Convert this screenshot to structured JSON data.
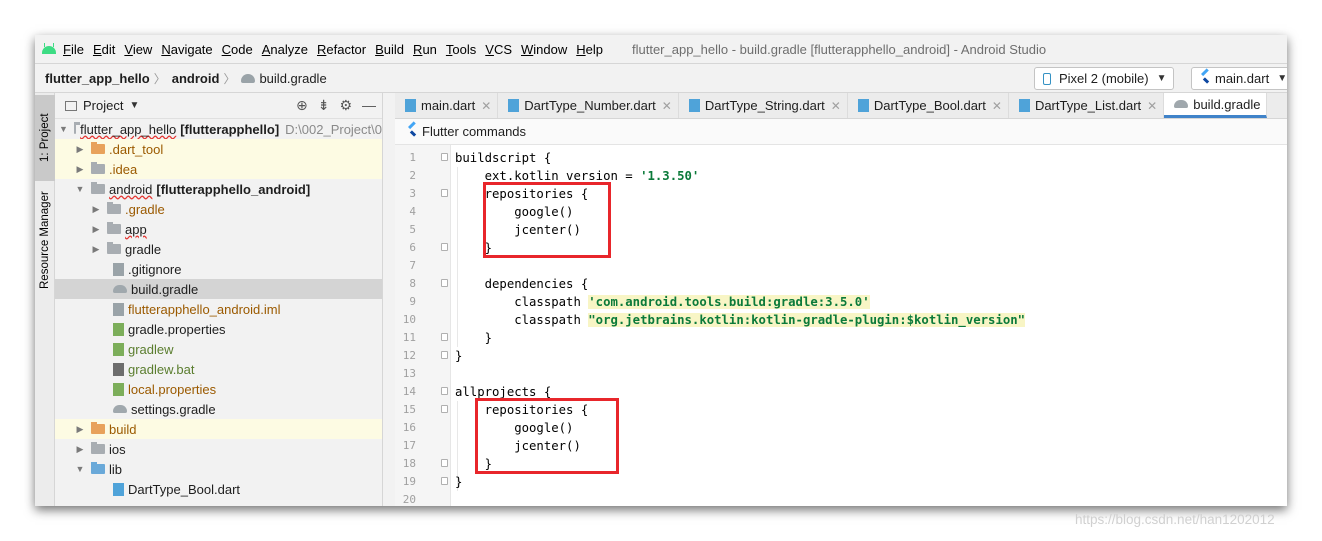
{
  "menu": {
    "items": [
      "File",
      "Edit",
      "View",
      "Navigate",
      "Code",
      "Analyze",
      "Refactor",
      "Build",
      "Run",
      "Tools",
      "VCS",
      "Window",
      "Help"
    ],
    "window_title": "flutter_app_hello - build.gradle [flutterapphello_android] - Android Studio"
  },
  "breadcrumb": {
    "project": "flutter_app_hello",
    "module": "android",
    "file": "build.gradle"
  },
  "toolbar": {
    "device": "Pixel 2 (mobile)",
    "run_config": "main.dart"
  },
  "side_stripe": {
    "project_tab": "1: Project",
    "resource_tab": "Resource Manager"
  },
  "project_panel": {
    "view_label": "Project",
    "tree": [
      {
        "name": "flutter_app_hello",
        "suffix": "[flutterapphello]",
        "path": "D:\\002_Project\\0"
      },
      {
        "name": ".dart_tool"
      },
      {
        "name": ".idea"
      },
      {
        "name": "android",
        "suffix": "[flutterapphello_android]"
      },
      {
        "name": ".gradle"
      },
      {
        "name": "app"
      },
      {
        "name": "gradle"
      },
      {
        "name": ".gitignore"
      },
      {
        "name": "build.gradle"
      },
      {
        "name": "flutterapphello_android.iml"
      },
      {
        "name": "gradle.properties"
      },
      {
        "name": "gradlew"
      },
      {
        "name": "gradlew.bat"
      },
      {
        "name": "local.properties"
      },
      {
        "name": "settings.gradle"
      },
      {
        "name": "build"
      },
      {
        "name": "ios"
      },
      {
        "name": "lib"
      },
      {
        "name": "DartType_Bool.dart"
      }
    ]
  },
  "editor": {
    "tabs": [
      "main.dart",
      "DartType_Number.dart",
      "DartType_String.dart",
      "DartType_Bool.dart",
      "DartType_List.dart",
      "build.gradle"
    ],
    "active_tab": "build.gradle",
    "flutter_bar": "Flutter commands",
    "line_numbers": [
      "1",
      "2",
      "3",
      "4",
      "5",
      "6",
      "7",
      "8",
      "9",
      "10",
      "11",
      "12",
      "13",
      "14",
      "15",
      "16",
      "17",
      "18",
      "19",
      "20"
    ],
    "lines": [
      {
        "plain": "buildscript {"
      },
      {
        "plain": "    ext.kotlin_version = ",
        "str": "'1.3.50'"
      },
      {
        "plain": "    repositories {"
      },
      {
        "plain": "        google()"
      },
      {
        "plain": "        jcenter()"
      },
      {
        "plain": "    }"
      },
      {
        "plain": ""
      },
      {
        "plain": "    dependencies {"
      },
      {
        "plain": "        classpath ",
        "str": "'com.android.tools.build:gradle:3.5.0'"
      },
      {
        "plain": "        classpath ",
        "str": "\"org.jetbrains.kotlin:kotlin-gradle-plugin:$kotlin_version\""
      },
      {
        "plain": "    }"
      },
      {
        "plain": "}"
      },
      {
        "plain": ""
      },
      {
        "plain": "allprojects {"
      },
      {
        "plain": "    repositories {"
      },
      {
        "plain": "        google()"
      },
      {
        "plain": "        jcenter()"
      },
      {
        "plain": "    }"
      },
      {
        "plain": "}"
      },
      {
        "plain": ""
      }
    ]
  },
  "watermark": "https://blog.csdn.net/han1202012"
}
